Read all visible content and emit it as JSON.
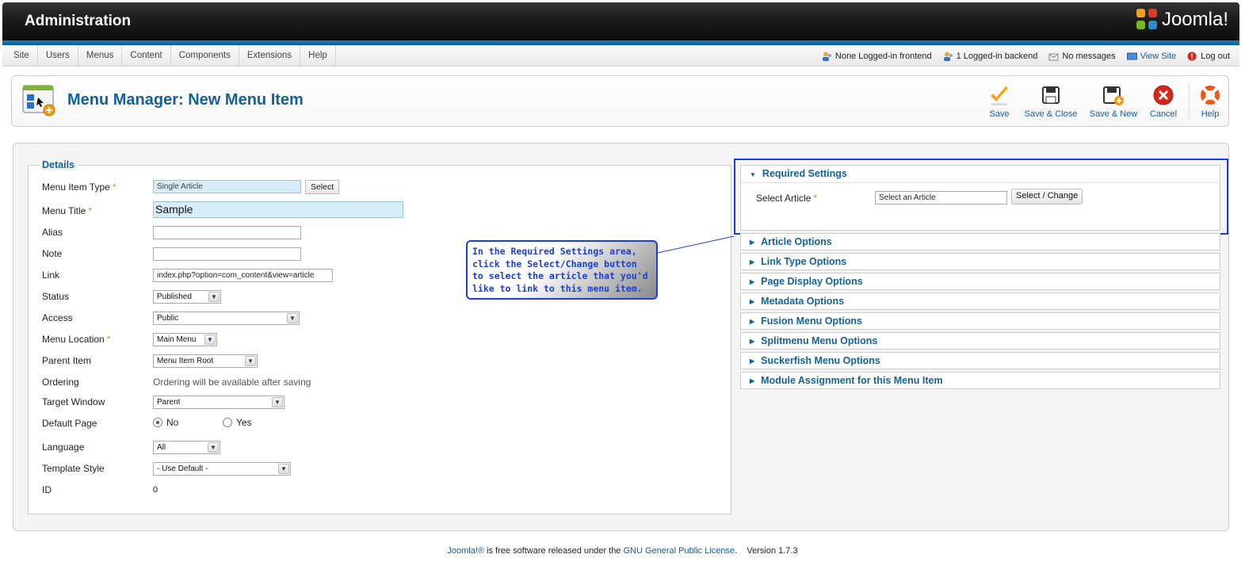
{
  "header": {
    "title": "Administration",
    "logo_text": "Joomla!"
  },
  "nav": {
    "menu": [
      "Site",
      "Users",
      "Menus",
      "Content",
      "Components",
      "Extensions",
      "Help"
    ],
    "status": {
      "frontend": "None Logged-in frontend",
      "backend": "1 Logged-in backend",
      "messages": "No messages",
      "view_site": "View Site",
      "logout": "Log out"
    }
  },
  "toolbar": {
    "page_title": "Menu Manager: New Menu Item",
    "buttons": [
      "Save",
      "Save & Close",
      "Save & New",
      "Cancel",
      "Help"
    ]
  },
  "details": {
    "legend": "Details",
    "labels": {
      "menu_item_type": "Menu Item Type",
      "menu_title": "Menu Title",
      "alias": "Alias",
      "note": "Note",
      "link": "Link",
      "status": "Status",
      "access": "Access",
      "menu_location": "Menu Location",
      "parent_item": "Parent Item",
      "ordering": "Ordering",
      "target_window": "Target Window",
      "default_page": "Default Page",
      "language": "Language",
      "template_style": "Template Style",
      "id": "ID"
    },
    "values": {
      "menu_item_type": "Single Article",
      "menu_item_type_button": "Select",
      "menu_title": "Sample",
      "alias": "",
      "note": "",
      "link": "index.php?option=com_content&view=article",
      "status": "Published",
      "access": "Public",
      "menu_location": "Main Menu",
      "parent_item": "Menu Item Root",
      "ordering": "Ordering will be available after saving",
      "target_window": "Parent",
      "default_page_no": "No",
      "default_page_yes": "Yes",
      "language": "All",
      "template_style": "- Use Default -",
      "id": "0"
    },
    "required_mark": "*"
  },
  "required_settings": {
    "title": "Required Settings",
    "select_article_label": "Select Article",
    "select_article_value": "Select an Article",
    "select_change_button": "Select / Change"
  },
  "option_panels": [
    "Article Options",
    "Link Type Options",
    "Page Display Options",
    "Metadata Options",
    "Fusion Menu Options",
    "Splitmenu Menu Options",
    "Suckerfish Menu Options",
    "Module Assignment for this Menu Item"
  ],
  "callout": {
    "text": "In the Required Settings area, click the Select/Change button to select the article that you'd like to link to this menu item."
  },
  "footer": {
    "brand": "Joomla!®",
    "text1": " is free software released under the ",
    "license": "GNU General Public License",
    "text2": ".    Version 1.7.3"
  },
  "colors": {
    "accent": "#146295",
    "highlight": "#1a3fd6",
    "header_blue": "#1e7fc8"
  }
}
